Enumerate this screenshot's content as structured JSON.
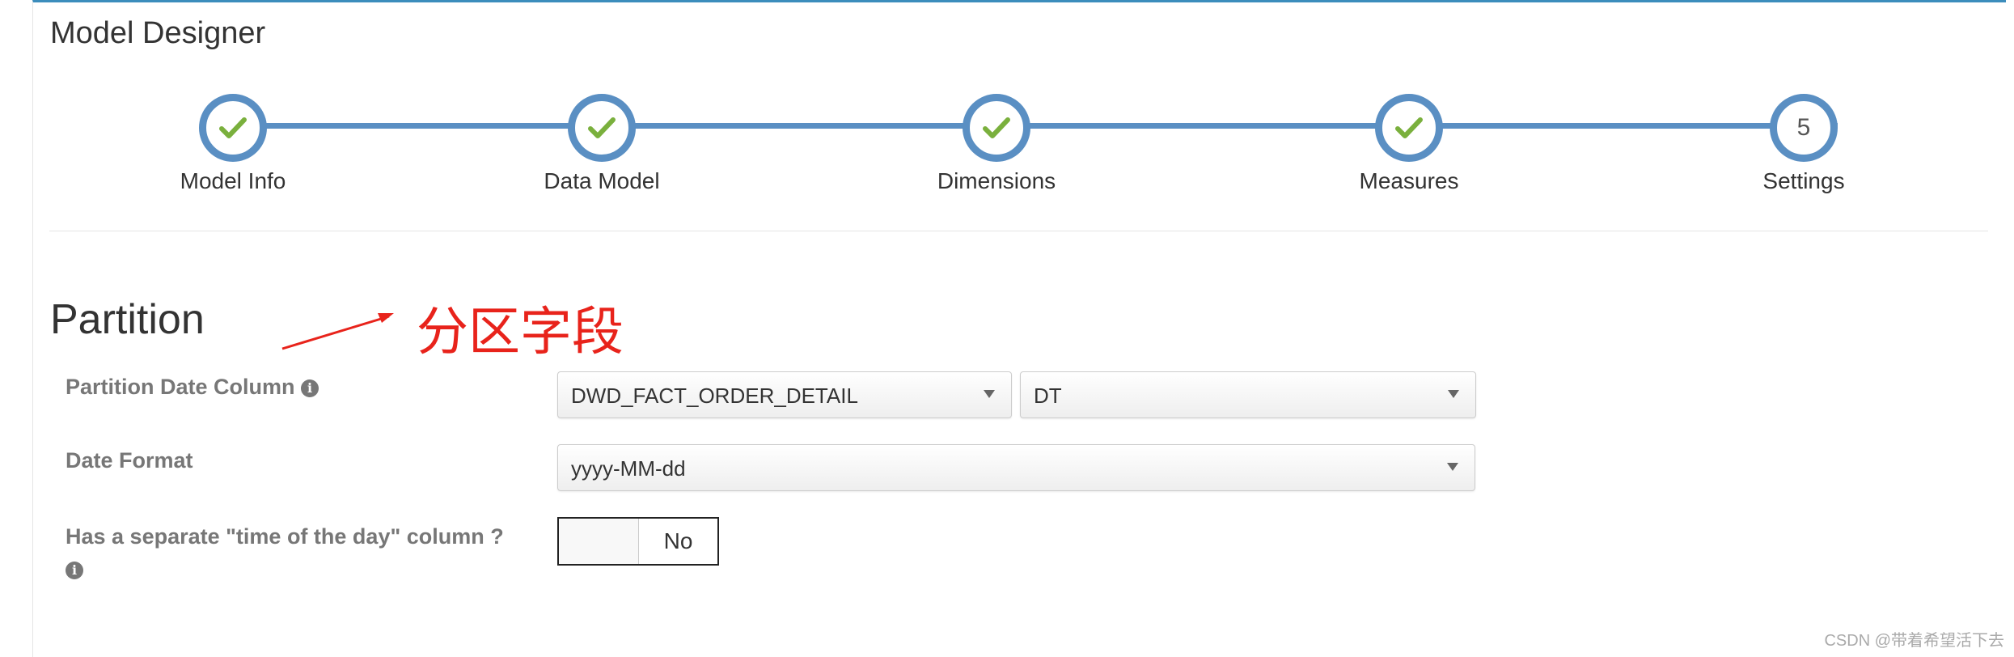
{
  "app": {
    "title": "Model Designer"
  },
  "wizard": {
    "steps": [
      {
        "label": "Model Info",
        "status": "complete",
        "icon": "check-icon"
      },
      {
        "label": "Data Model",
        "status": "complete",
        "icon": "check-icon"
      },
      {
        "label": "Dimensions",
        "status": "complete",
        "icon": "check-icon"
      },
      {
        "label": "Measures",
        "status": "complete",
        "icon": "check-icon"
      },
      {
        "label": "Settings",
        "status": "current",
        "number": "5"
      }
    ],
    "line_color": "#5a8fc3",
    "check_color": "#7ab03d"
  },
  "partition": {
    "title": "Partition",
    "annotation": "分区字段",
    "annotation_color": "#e8231b",
    "date_column": {
      "label": "Partition Date Column",
      "table_value": "DWD_FACT_ORDER_DETAIL",
      "column_value": "DT"
    },
    "date_format": {
      "label": "Date Format",
      "value": "yyyy-MM-dd"
    },
    "time_column": {
      "label": "Has a separate \"time of the day\" column ?",
      "toggle_value": "No"
    }
  },
  "watermark": "CSDN @带着希望活下去"
}
